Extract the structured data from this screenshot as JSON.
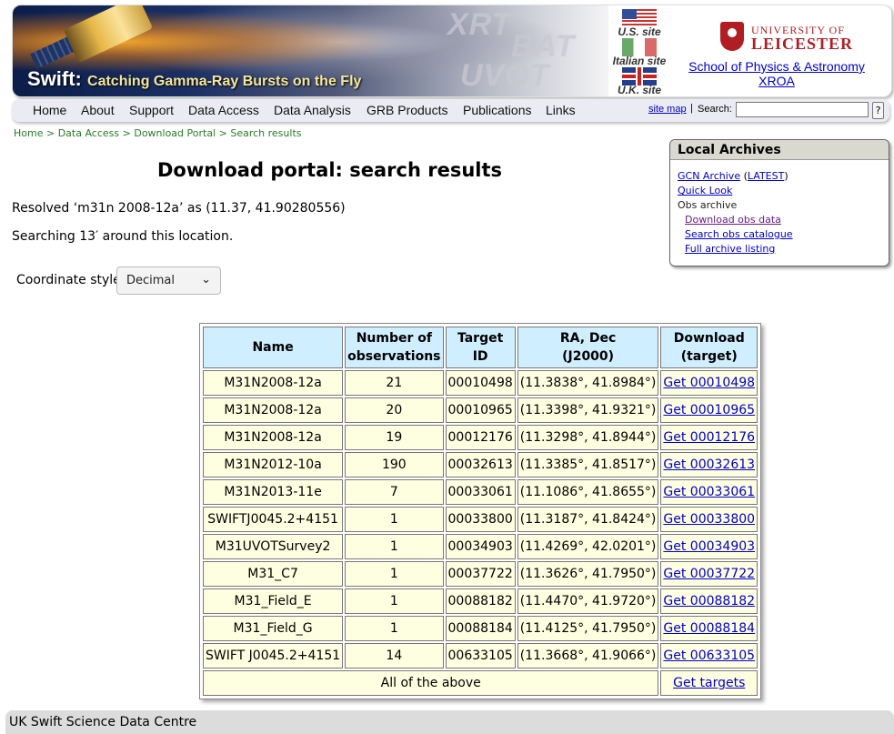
{
  "header": {
    "banner_title": "Swift:",
    "banner_subtitle": "Catching Gamma-Ray Bursts on the Fly",
    "instruments": [
      "XRT",
      "BAT",
      "UVOT"
    ],
    "sites": [
      {
        "label": "U.S. site",
        "flag": "us-flag-icon"
      },
      {
        "label": "Italian site",
        "flag": "italy-flag-icon"
      },
      {
        "label": "U.K. site",
        "flag": "uk-flag-icon"
      }
    ],
    "university_line1": "UNIVERSITY OF",
    "university_line2": "LEICESTER",
    "school_line1": "School of Physics & Astronomy",
    "school_line2": "XROA"
  },
  "nav": {
    "items": [
      "Home",
      "About",
      "Support",
      "Data Access",
      "Data Analysis",
      "GRB Products",
      "Publications",
      "Links"
    ],
    "site_map": "site map",
    "separator": "|",
    "search_label": "Search:",
    "search_value": "",
    "help_label": "?"
  },
  "breadcrumb": {
    "items": [
      "Home",
      "Data Access",
      "Download Portal"
    ],
    "sep": ">",
    "current": "Search results"
  },
  "sidebox": {
    "title": "Local Archives",
    "gcn": "GCN Archive",
    "latest": "LATEST",
    "quick_look": "Quick Look",
    "obs_archive": "Obs archive",
    "download_obs": "Download obs data",
    "search_obs": "Search obs catalogue",
    "full_listing": "Full archive listing"
  },
  "main": {
    "title": "Download portal: search results",
    "resolved": "Resolved ‘m31n 2008-12a’ as (11.37, 41.90280556)",
    "searching": "Searching 13′ around this location.",
    "coord_label": "Coordinate style",
    "coord_value": "Decimal"
  },
  "table": {
    "headers": {
      "name": "Name",
      "nobs_1": "Number of",
      "nobs_2": "observations",
      "tid": "Target ID",
      "radec_1": "RA, Dec",
      "radec_2": "(J2000)",
      "dl_1": "Download",
      "dl_2": "(target)"
    },
    "rows": [
      {
        "name": "M31N2008-12a",
        "nobs": "21",
        "tid": "00010498",
        "coords": "(11.3838°, 41.8984°)",
        "link": "Get 00010498"
      },
      {
        "name": "M31N2008-12a",
        "nobs": "20",
        "tid": "00010965",
        "coords": "(11.3398°, 41.9321°)",
        "link": "Get 00010965"
      },
      {
        "name": "M31N2008-12a",
        "nobs": "19",
        "tid": "00012176",
        "coords": "(11.3298°, 41.8944°)",
        "link": "Get 00012176"
      },
      {
        "name": "M31N2012-10a",
        "nobs": "190",
        "tid": "00032613",
        "coords": "(11.3385°, 41.8517°)",
        "link": "Get 00032613"
      },
      {
        "name": "M31N2013-11e",
        "nobs": "7",
        "tid": "00033061",
        "coords": "(11.1086°, 41.8655°)",
        "link": "Get 00033061"
      },
      {
        "name": "SWIFTJ0045.2+4151",
        "nobs": "1",
        "tid": "00033800",
        "coords": "(11.3187°, 41.8424°)",
        "link": "Get 00033800"
      },
      {
        "name": "M31UVOTSurvey2",
        "nobs": "1",
        "tid": "00034903",
        "coords": "(11.4269°, 42.0201°)",
        "link": "Get 00034903"
      },
      {
        "name": "M31_C7",
        "nobs": "1",
        "tid": "00037722",
        "coords": "(11.3626°, 41.7950°)",
        "link": "Get 00037722"
      },
      {
        "name": "M31_Field_E",
        "nobs": "1",
        "tid": "00088182",
        "coords": "(11.4470°, 41.9720°)",
        "link": "Get 00088182"
      },
      {
        "name": "M31_Field_G",
        "nobs": "1",
        "tid": "00088184",
        "coords": "(11.4125°, 41.7950°)",
        "link": "Get 00088184"
      },
      {
        "name": "SWIFT J0045.2+4151",
        "nobs": "14",
        "tid": "00633105",
        "coords": "(11.3668°, 41.9066°)",
        "link": "Get 00633105"
      }
    ],
    "all_label": "All of the above",
    "all_link": "Get targets"
  },
  "footer": {
    "text": "UK Swift Science Data Centre"
  }
}
